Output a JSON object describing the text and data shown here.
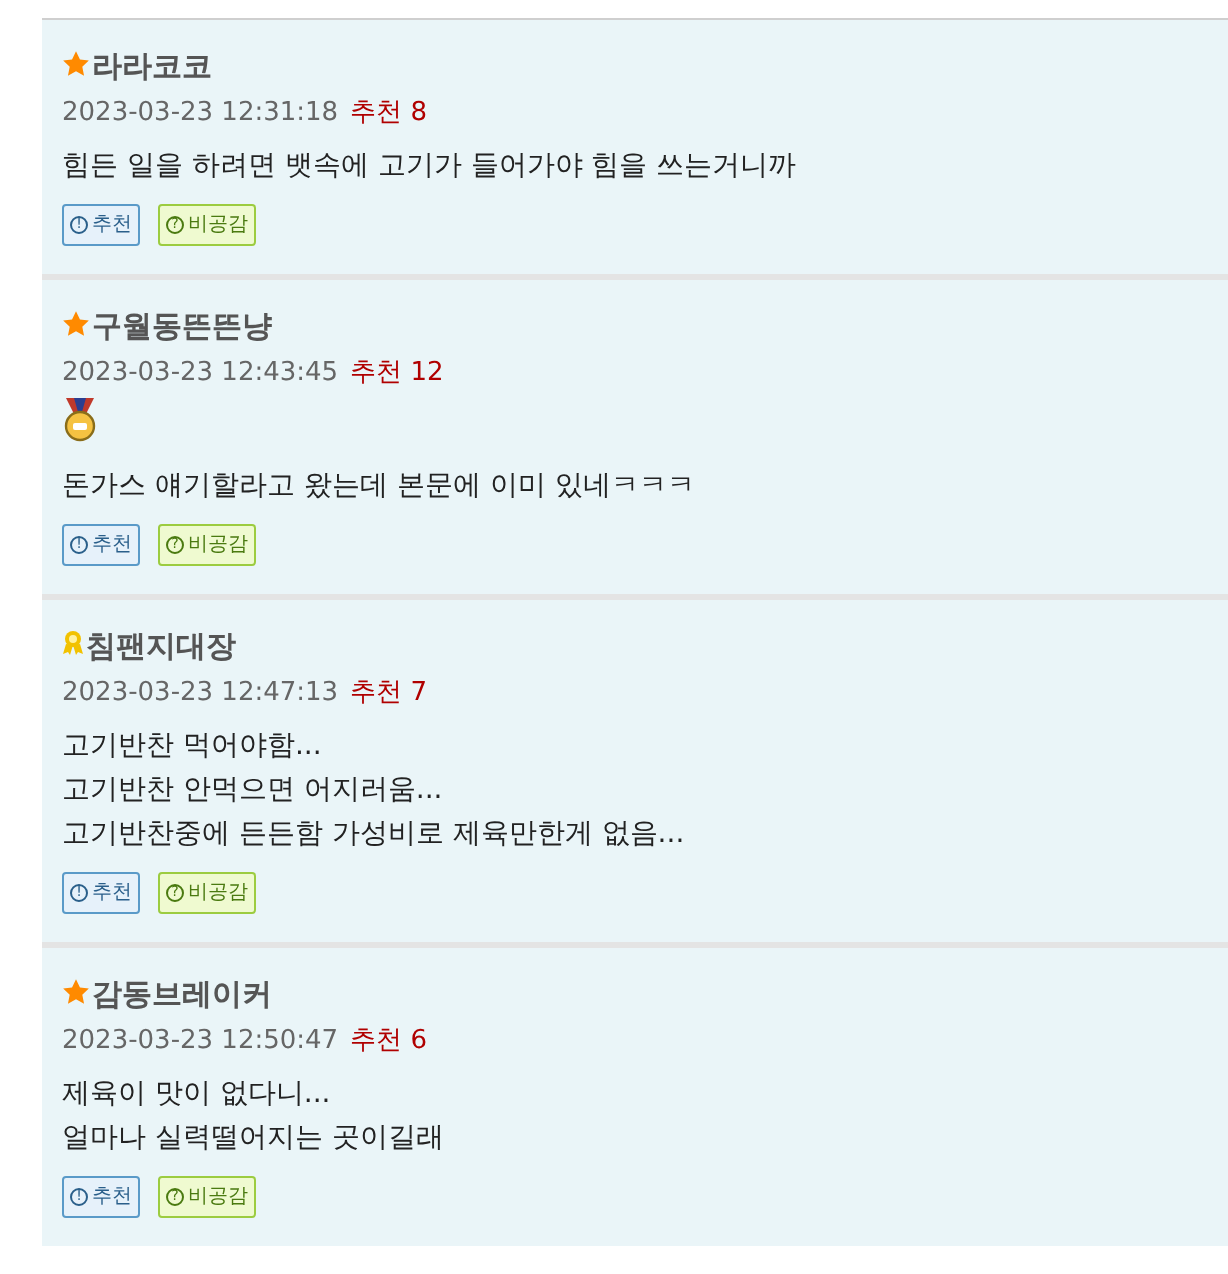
{
  "comments": [
    {
      "kind": "star",
      "author": "라라코코",
      "date": "2023-03-23 12:31:18",
      "recommend_label": "추천",
      "recommend_count": "8",
      "medal": false,
      "lines": [
        "힘든 일을 하려면 뱃속에 고기가 들어가야 힘을 쓰는거니까"
      ],
      "buttons": [
        {
          "kind": "recommend",
          "icon": "!",
          "label": "추천"
        },
        {
          "kind": "disagree",
          "icon": "?",
          "label": "비공감"
        }
      ]
    },
    {
      "kind": "star",
      "author": "구월동뜬뜬냥",
      "date": "2023-03-23 12:43:45",
      "recommend_label": "추천",
      "recommend_count": "12",
      "medal": true,
      "lines": [
        "돈가스 얘기할라고 왔는데 본문에 이미 있네ㅋㅋㅋ"
      ],
      "buttons": [
        {
          "kind": "recommend",
          "icon": "!",
          "label": "추천"
        },
        {
          "kind": "disagree",
          "icon": "?",
          "label": "비공감"
        }
      ]
    },
    {
      "kind": "ribbon",
      "author": "침팬지대장",
      "date": "2023-03-23 12:47:13",
      "recommend_label": "추천",
      "recommend_count": "7",
      "medal": false,
      "lines": [
        "고기반찬 먹어야함...",
        "고기반찬 안먹으면 어지러움...",
        "고기반찬중에 든든함 가성비로 제육만한게 없음..."
      ],
      "buttons": [
        {
          "kind": "recommend",
          "icon": "!",
          "label": "추천"
        },
        {
          "kind": "disagree",
          "icon": "?",
          "label": "비공감"
        }
      ]
    },
    {
      "kind": "star",
      "author": "감동브레이커",
      "date": "2023-03-23 12:50:47",
      "recommend_label": "추천",
      "recommend_count": "6",
      "medal": false,
      "lines": [
        "제육이 맛이 없다니...",
        "얼마나 실력떨어지는 곳이길래"
      ],
      "buttons": [
        {
          "kind": "recommend",
          "icon": "!",
          "label": "추천"
        },
        {
          "kind": "disagree",
          "icon": "?",
          "label": "비공감"
        }
      ]
    }
  ]
}
